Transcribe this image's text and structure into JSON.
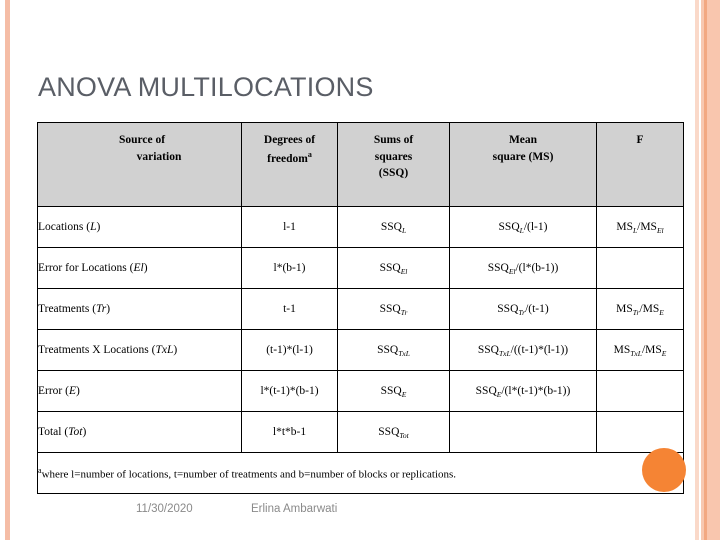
{
  "slide": {
    "title": "ANOVA MULTILOCATIONS",
    "accent_color": "#F58434",
    "stripe_color": "#F5BDA6",
    "header_fill": "#D1D1D1"
  },
  "table": {
    "headers": {
      "source_line1": "Source of",
      "source_line2": "variation",
      "df_line1": "Degrees of",
      "df_line2": "freedom",
      "df_superscript": "a",
      "ssq_line1": "Sums of",
      "ssq_line2": "squares",
      "ssq_line3": "(SSQ)",
      "ms_line1": "Mean",
      "ms_line2": "square (MS)",
      "f": "F"
    },
    "rows": [
      {
        "source_text": "Locations (",
        "source_symbol": "L",
        "source_close": ")",
        "df": "l-1",
        "ssq_base": "SSQ",
        "ssq_sub": "L",
        "ms_base": "SSQ",
        "ms_sub": "L",
        "ms_rest": "/(l-1)",
        "f_base1": "MS",
        "f_sub1": "L",
        "f_mid": "/MS",
        "f_sub2": "El"
      },
      {
        "source_text": "Error for Locations (",
        "source_symbol": "El",
        "source_close": ")",
        "df": "l*(b-1)",
        "ssq_base": "SSQ",
        "ssq_sub": "El",
        "ms_base": "SSQ",
        "ms_sub": "El",
        "ms_rest": "/(l*(b-1))",
        "f_base1": "",
        "f_sub1": "",
        "f_mid": "",
        "f_sub2": ""
      },
      {
        "source_text": "Treatments (",
        "source_symbol": "Tr",
        "source_close": ")",
        "df": "t-1",
        "ssq_base": "SSQ",
        "ssq_sub": "Tr",
        "ms_base": "SSQ",
        "ms_sub": "Tr",
        "ms_rest": "/(t-1)",
        "f_base1": "MS",
        "f_sub1": "Tr",
        "f_mid": "/MS",
        "f_sub2": "E"
      },
      {
        "source_text": "Treatments X Locations (",
        "source_symbol": "TxL",
        "source_close": ")",
        "df": "(t-1)*(l-1)",
        "ssq_base": "SSQ",
        "ssq_sub": "TxL",
        "ms_base": "SSQ",
        "ms_sub": "TxL",
        "ms_rest": "/((t-1)*(l-1))",
        "f_base1": "MS",
        "f_sub1": "TxL",
        "f_mid": "/MS",
        "f_sub2": "E"
      },
      {
        "source_text": "Error (",
        "source_symbol": "E",
        "source_close": ")",
        "df": "l*(t-1)*(b-1)",
        "ssq_base": "SSQ",
        "ssq_sub": "E",
        "ms_base": "SSQ",
        "ms_sub": "E",
        "ms_rest": "/(l*(t-1)*(b-1))",
        "f_base1": "",
        "f_sub1": "",
        "f_mid": "",
        "f_sub2": ""
      },
      {
        "source_text": "Total (",
        "source_symbol": "Tot",
        "source_close": ")",
        "df": "l*t*b-1",
        "ssq_base": "SSQ",
        "ssq_sub": "Tot",
        "ms_base": "",
        "ms_sub": "",
        "ms_rest": "",
        "f_base1": "",
        "f_sub1": "",
        "f_mid": "",
        "f_sub2": ""
      }
    ],
    "footnote_marker": "a",
    "footnote": "where l=number of locations, t=number of treatments and b=number of blocks or replications."
  },
  "footer": {
    "date": "11/30/2020",
    "author": "Erlina Ambarwati"
  }
}
